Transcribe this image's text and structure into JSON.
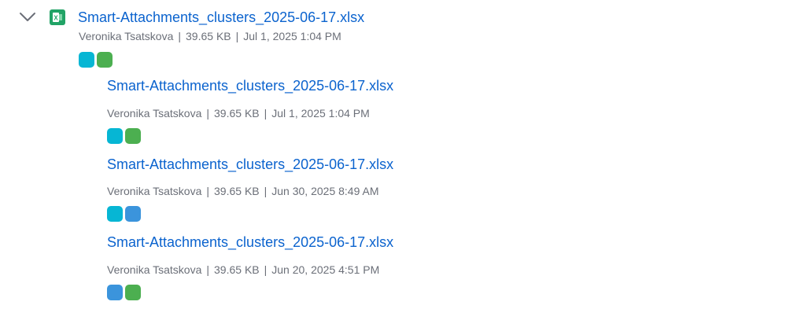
{
  "parent": {
    "title": "Smart-Attachments_clusters_2025-06-17.xlsx",
    "author": "Veronika Tsatskova",
    "size": "39.65 KB",
    "date": "Jul 1, 2025 1:04 PM",
    "separator": "|",
    "tag_colors": [
      "#06b6d4",
      "#4caf50"
    ],
    "icon": "excel-file-icon",
    "icon_letter": "X"
  },
  "versions": [
    {
      "title": "Smart-Attachments_clusters_2025-06-17.xlsx",
      "author": "Veronika Tsatskova",
      "size": "39.65 KB",
      "date": "Jul 1, 2025 1:04 PM",
      "separator": "|",
      "tag_colors": [
        "#06b6d4",
        "#4caf50"
      ]
    },
    {
      "title": "Smart-Attachments_clusters_2025-06-17.xlsx",
      "author": "Veronika Tsatskova",
      "size": "39.65 KB",
      "date": "Jun 30, 2025 8:49 AM",
      "separator": "|",
      "tag_colors": [
        "#06b6d4",
        "#3b94dc"
      ]
    },
    {
      "title": "Smart-Attachments_clusters_2025-06-17.xlsx",
      "author": "Veronika Tsatskova",
      "size": "39.65 KB",
      "date": "Jun 20, 2025 4:51 PM",
      "separator": "|",
      "tag_colors": [
        "#3b94dc",
        "#4caf50"
      ]
    }
  ]
}
